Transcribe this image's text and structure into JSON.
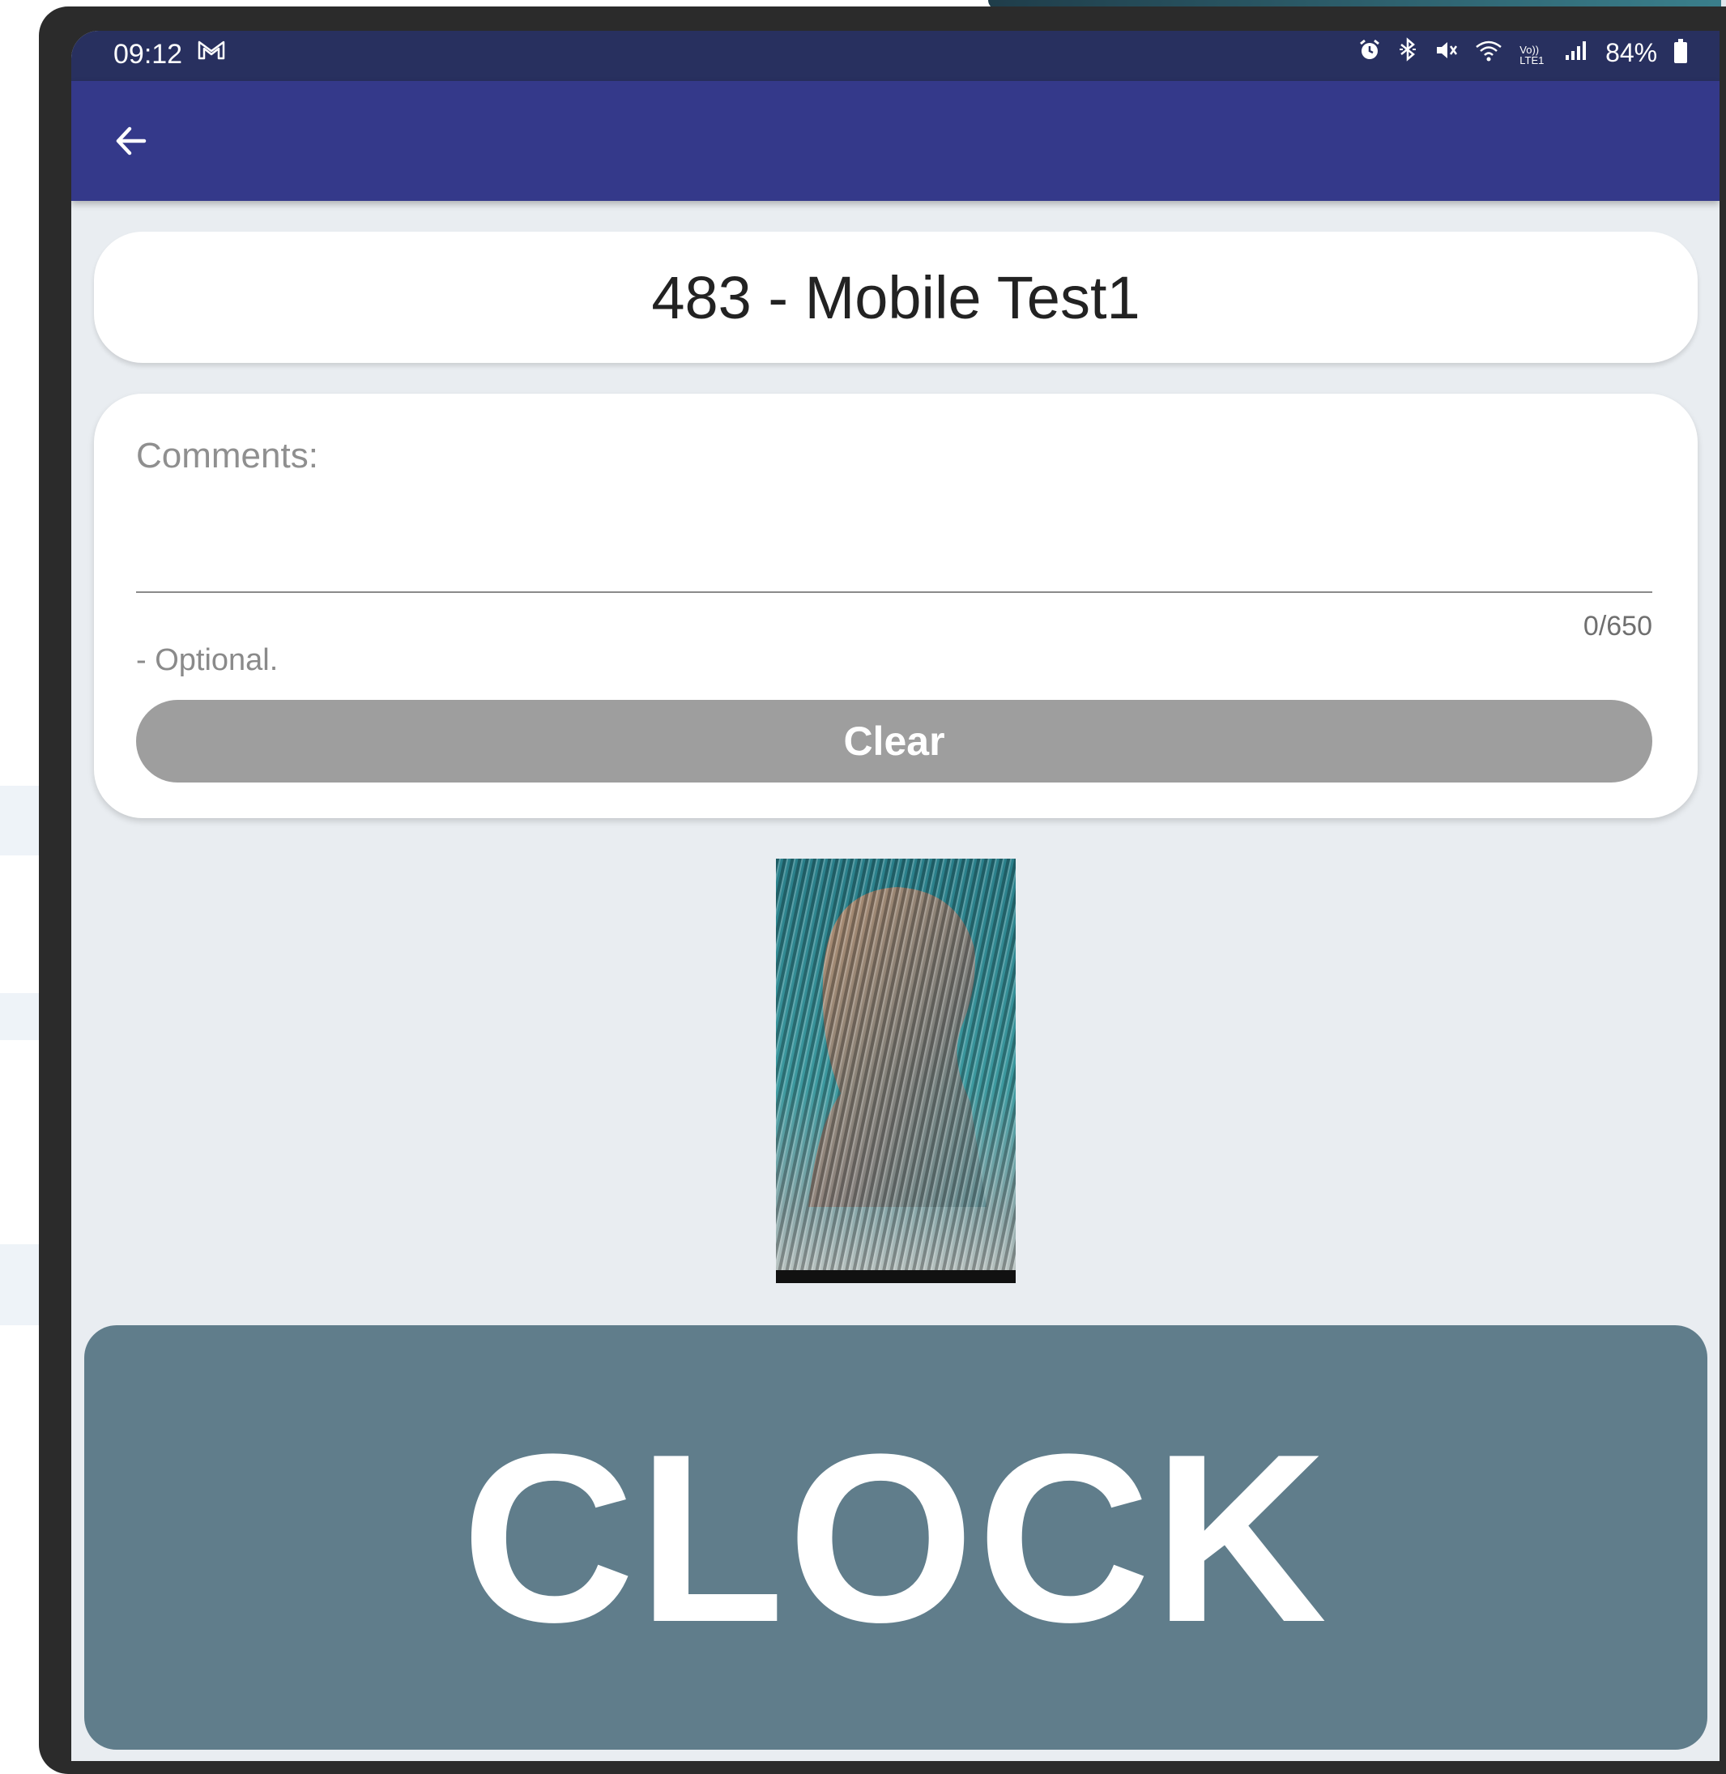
{
  "status_bar": {
    "time": "09:12",
    "mail_icon": "gmail-icon",
    "icons": [
      "alarm-icon",
      "bluetooth-icon",
      "mute-icon",
      "wifi-icon",
      "volte-icon",
      "signal-icon"
    ],
    "volte_label": "Vo)) LTE1",
    "battery": "84%"
  },
  "app_bar": {
    "back_icon": "arrow-left-icon"
  },
  "title": "483 - Mobile Test1",
  "comments": {
    "label": "Comments:",
    "value": "",
    "counter": "0/650",
    "hint": "- Optional.",
    "clear_label": "Clear"
  },
  "photo": {
    "description_icon": "captured-face-photo"
  },
  "clock_label": "CLOCK",
  "colors": {
    "status_bar": "#28305f",
    "app_bar": "#34398a",
    "screen_bg": "#e9edf1",
    "clear_button": "#9e9e9e",
    "clock_button": "#607d8b"
  }
}
